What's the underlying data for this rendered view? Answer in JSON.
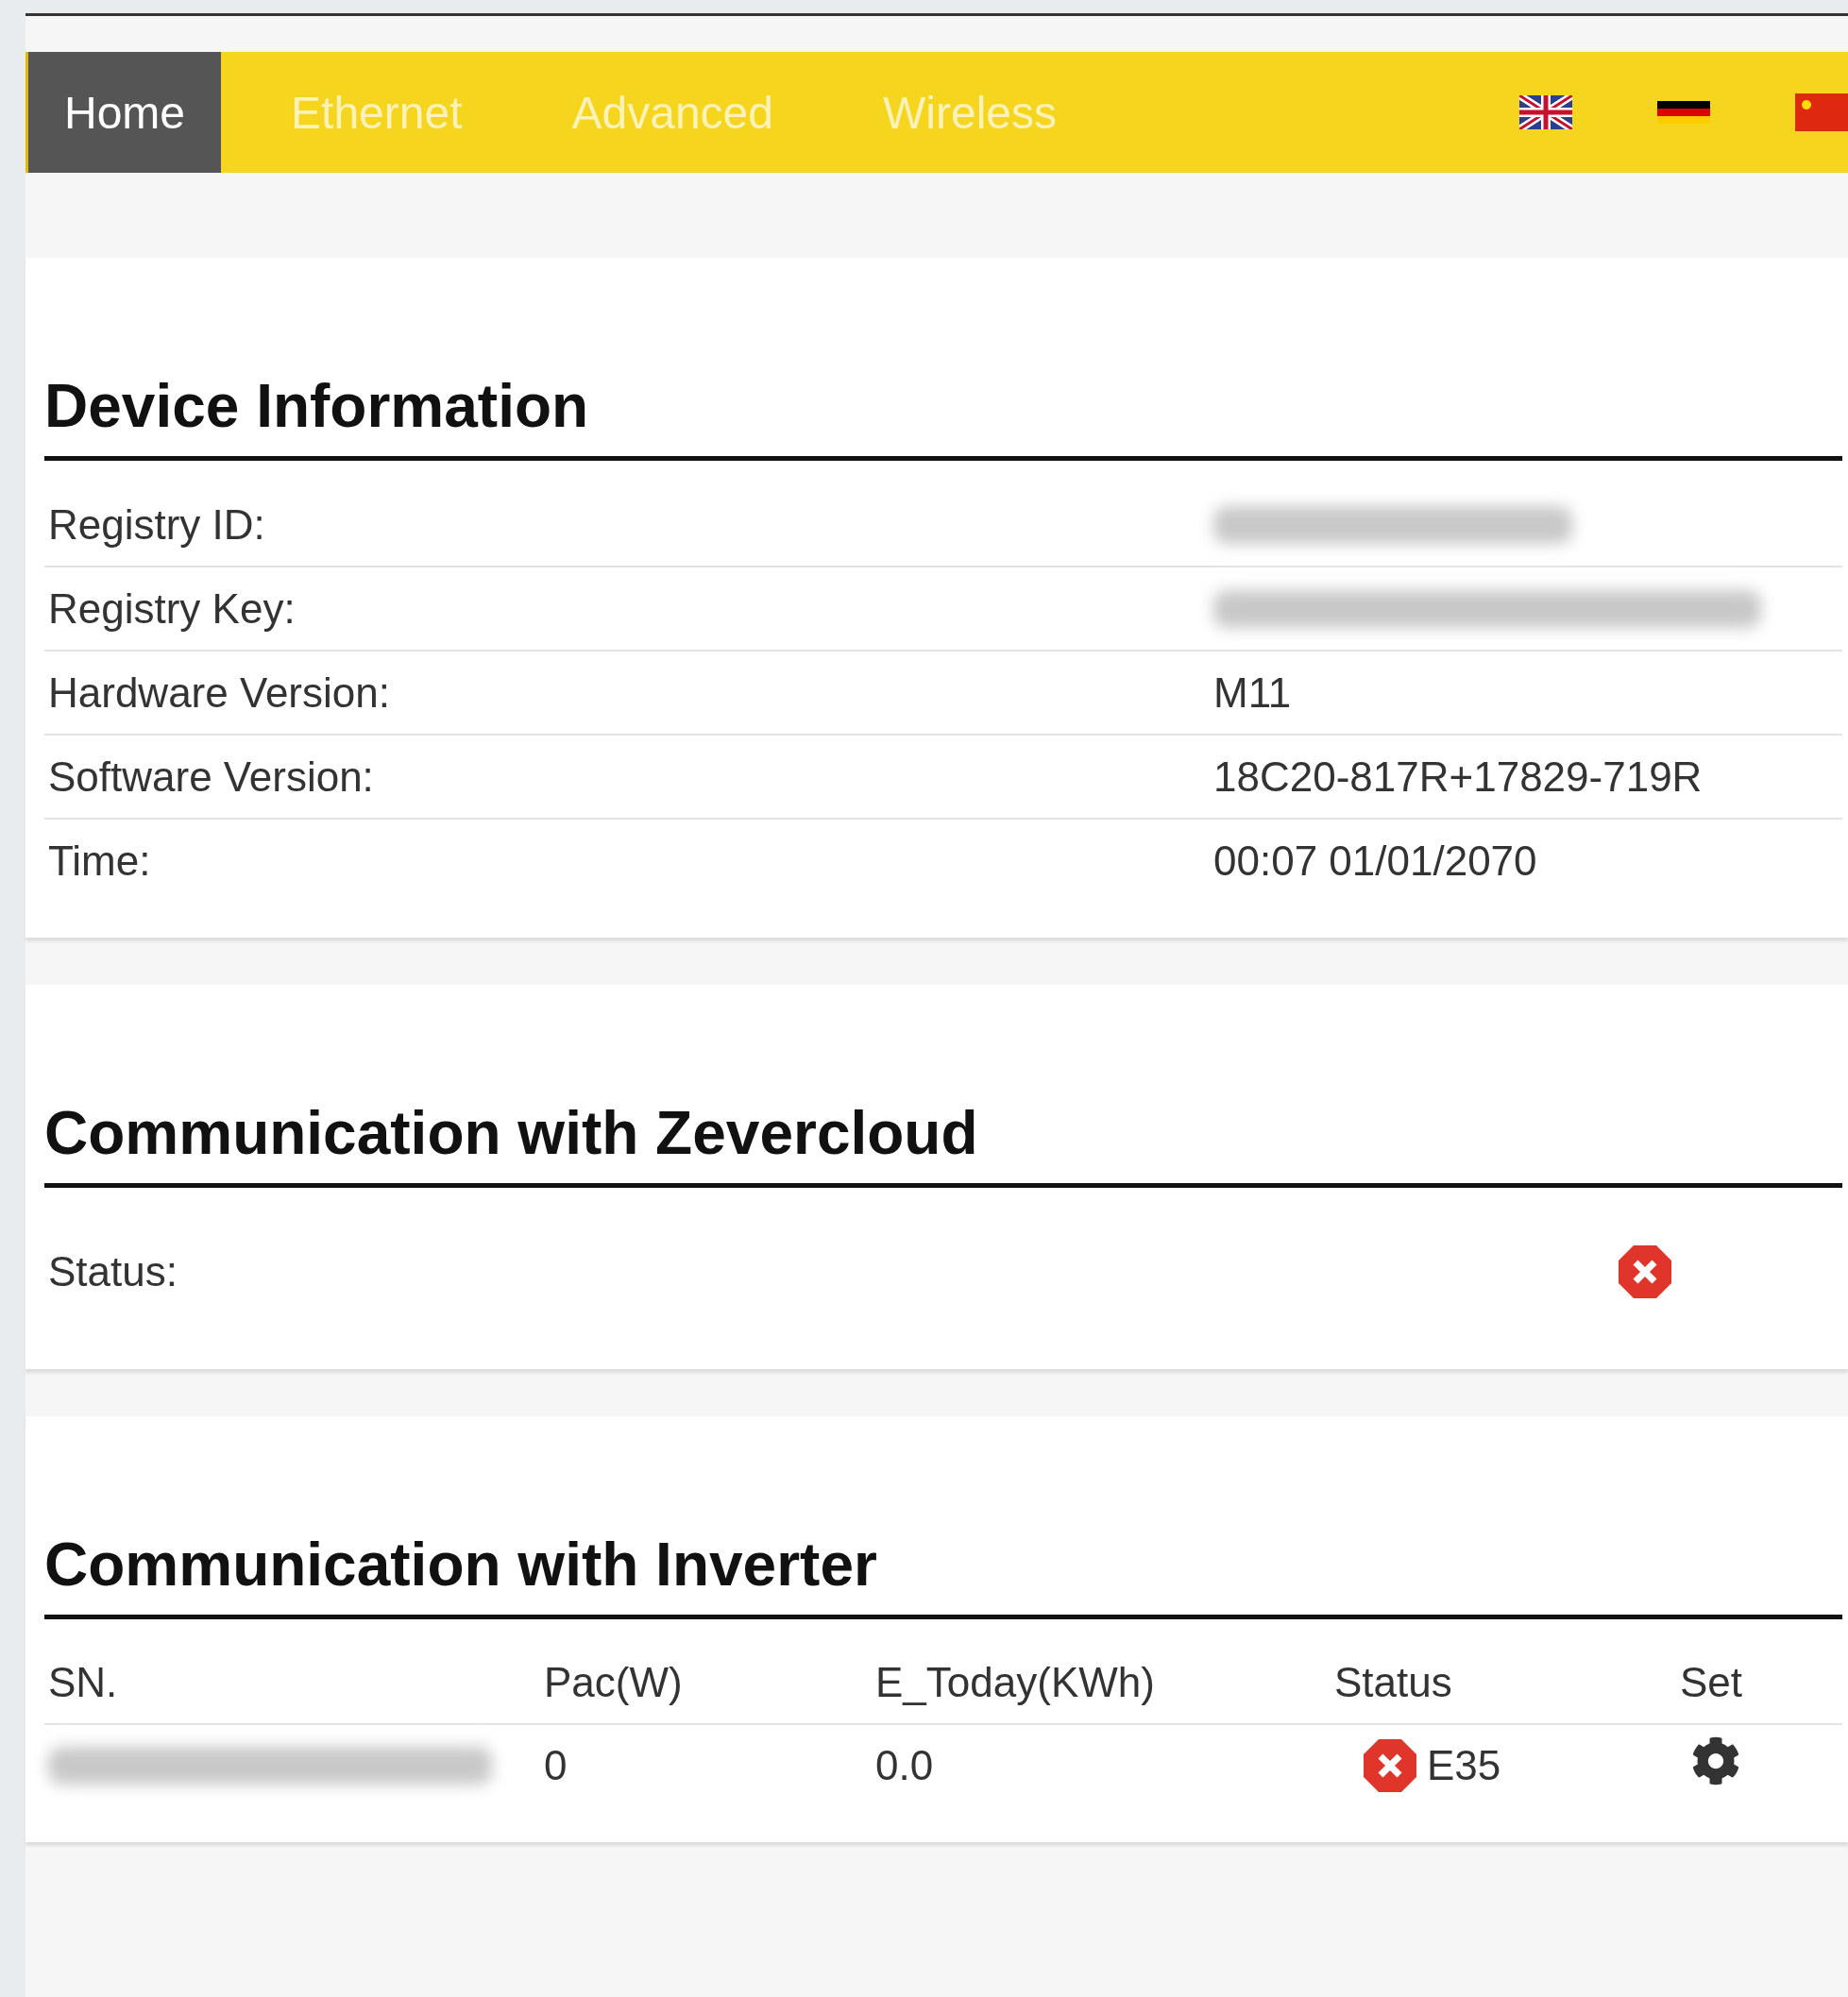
{
  "nav": {
    "tabs": [
      {
        "label": "Home",
        "selected": true
      },
      {
        "label": "Ethernet",
        "selected": false
      },
      {
        "label": "Advanced",
        "selected": false
      },
      {
        "label": "Wireless",
        "selected": false
      }
    ],
    "languages": [
      {
        "kind": "uk"
      },
      {
        "kind": "de"
      },
      {
        "kind": "cn"
      }
    ]
  },
  "device_information": {
    "title": "Device Information",
    "rows": [
      {
        "label": "Registry ID:",
        "kind": "redacted"
      },
      {
        "label": "Registry Key:",
        "kind": "redacted"
      },
      {
        "label": "Hardware Version:",
        "kind": "text",
        "value": "M11"
      },
      {
        "label": "Software Version:",
        "kind": "text",
        "value": "18C20-817R+17829-719R"
      },
      {
        "label": "Time:",
        "kind": "text",
        "value": "00:07 01/01/2070"
      }
    ]
  },
  "zevercloud": {
    "title": "Communication with Zevercloud",
    "status_label": "Status:",
    "status_ok": false
  },
  "inverter": {
    "title": "Communication with Inverter",
    "columns": [
      "SN.",
      "Pac(W)",
      "E_Today(KWh)",
      "Status",
      "Set"
    ],
    "rows": [
      {
        "sn_redacted": true,
        "pac": "0",
        "e_today": "0.0",
        "status_ok": false,
        "status_code": "E35"
      }
    ]
  }
}
